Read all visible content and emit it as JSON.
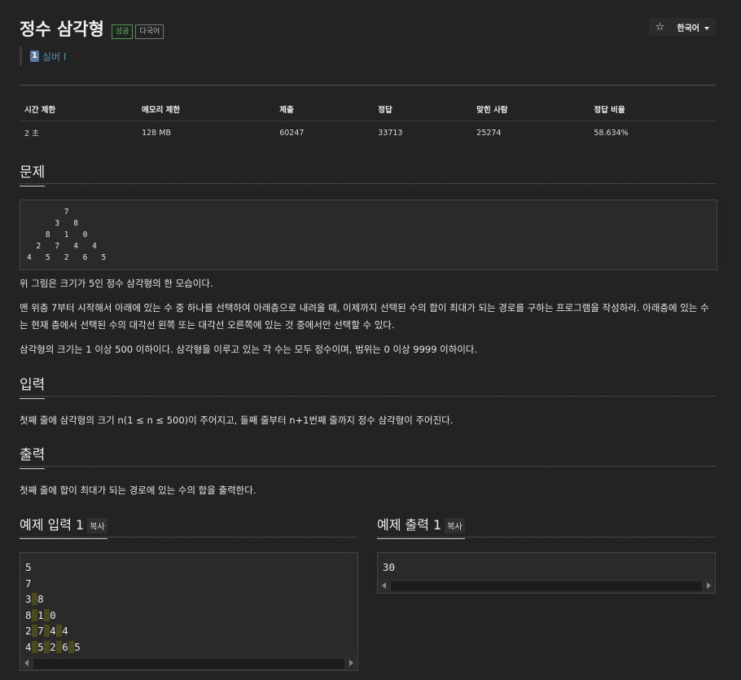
{
  "problem": {
    "title": "정수 삼각형",
    "label_success": "성공",
    "label_lang": "다국어",
    "tier_number": "1",
    "tier": "실버 I"
  },
  "toolbar": {
    "star": "☆",
    "language": "한국어"
  },
  "info_table": {
    "headers": [
      "시간 제한",
      "메모리 제한",
      "제출",
      "정답",
      "맞힌 사람",
      "정답 비율"
    ],
    "values": [
      "2 초",
      "128 MB",
      "60247",
      "33713",
      "25274",
      "58.634%"
    ]
  },
  "sections": {
    "description_title": "문제",
    "triangle": "        7\n      3   8\n    8   1   0\n  2   7   4   4\n4   5   2   6   5",
    "description": [
      "위 그림은 크기가 5인 정수 삼각형의 한 모습이다.",
      "맨 위층 7부터 시작해서 아래에 있는 수 중 하나를 선택하여 아래층으로 내려올 때, 이제까지 선택된 수의 합이 최대가 되는 경로를 구하는 프로그램을 작성하라. 아래층에 있는 수는 현재 층에서 선택된 수의 대각선 왼쪽 또는 대각선 오른쪽에 있는 것 중에서만 선택할 수 있다.",
      "삼각형의 크기는 1 이상 500 이하이다. 삼각형을 이루고 있는 각 수는 모두 정수이며, 범위는 0 이상 9999 이하이다."
    ],
    "input_title": "입력",
    "input_text": "첫째 줄에 삼각형의 크기 n(1 ≤ n ≤ 500)이 주어지고, 둘째 줄부터 n+1번째 줄까지 정수 삼각형이 주어진다.",
    "output_title": "출력",
    "output_text": "첫째 줄에 합이 최대가 되는 경로에 있는 수의 합을 출력한다."
  },
  "samples": {
    "input_title": "예제 입력 1",
    "output_title": "예제 출력 1",
    "copy_label": "복사",
    "input_lines": [
      [
        "5"
      ],
      [
        "7"
      ],
      [
        "3",
        "8"
      ],
      [
        "8",
        "1",
        "0"
      ],
      [
        "2",
        "7",
        "4",
        "4"
      ],
      [
        "4",
        "5",
        "2",
        "6",
        "5"
      ]
    ],
    "output": "30"
  }
}
